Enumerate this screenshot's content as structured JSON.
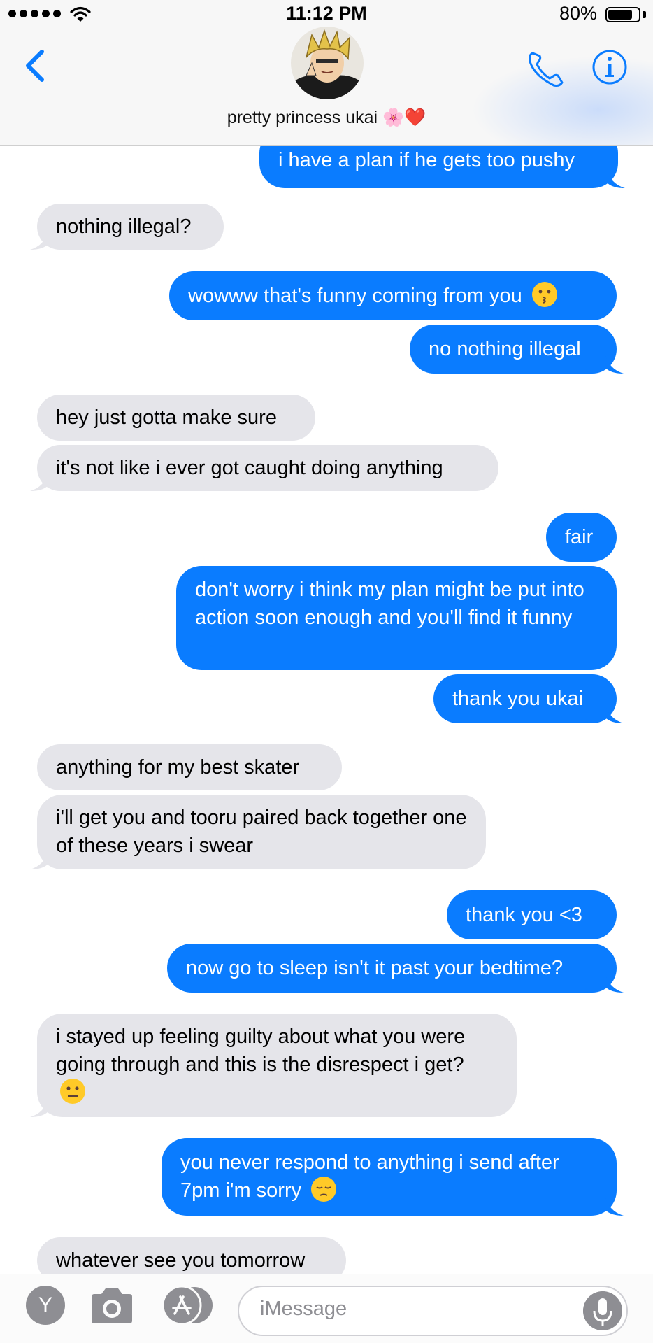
{
  "status_bar": {
    "time": "11:12 PM",
    "battery": "80%",
    "battery_level": 0.8
  },
  "header": {
    "contact_name": "pretty princess ukai 🌸❤️",
    "icons": [
      "back-chevron-icon",
      "avatar",
      "phone-icon",
      "info-icon"
    ]
  },
  "messages": [
    {
      "side": "out",
      "text": "i have a plan if he gets too pushy"
    },
    {
      "side": "in",
      "text": "nothing illegal?"
    },
    {
      "side": "out",
      "text": "wowww that's funny coming from you",
      "emoji": "kissing-face-emoji"
    },
    {
      "side": "out",
      "text": "no nothing illegal"
    },
    {
      "side": "in",
      "text": "hey just gotta make sure"
    },
    {
      "side": "in",
      "text": "it's not like i ever got caught doing anything"
    },
    {
      "side": "out",
      "text": "fair"
    },
    {
      "side": "out",
      "text": "don't worry i think my plan might be put into action soon enough and you'll find it funny"
    },
    {
      "side": "out",
      "text": "thank you ukai"
    },
    {
      "side": "in",
      "text": "anything for my best skater"
    },
    {
      "side": "in",
      "text": "i'll get you and tooru paired back together one of these years i swear"
    },
    {
      "side": "out",
      "text": "thank you <3"
    },
    {
      "side": "out",
      "text": "now go to sleep isn't it past your bedtime?"
    },
    {
      "side": "in",
      "text": "i stayed up feeling guilty about what you were going through and this is the disrespect i get?",
      "emoji": "neutral-face-emoji"
    },
    {
      "side": "out",
      "text": "you never respond to anything i send after 7pm i'm sorry",
      "emoji": "pensive-face-emoji"
    },
    {
      "side": "in",
      "text": "whatever see you tomorrow"
    }
  ],
  "composer": {
    "placeholder": "iMessage",
    "icons": [
      "app-y-icon",
      "camera-icon",
      "app-store-icon",
      "microphone-icon"
    ]
  },
  "colors": {
    "outgoing": "#0a7cff",
    "incoming": "#e5e5ea",
    "accent": "#0a7cff"
  }
}
